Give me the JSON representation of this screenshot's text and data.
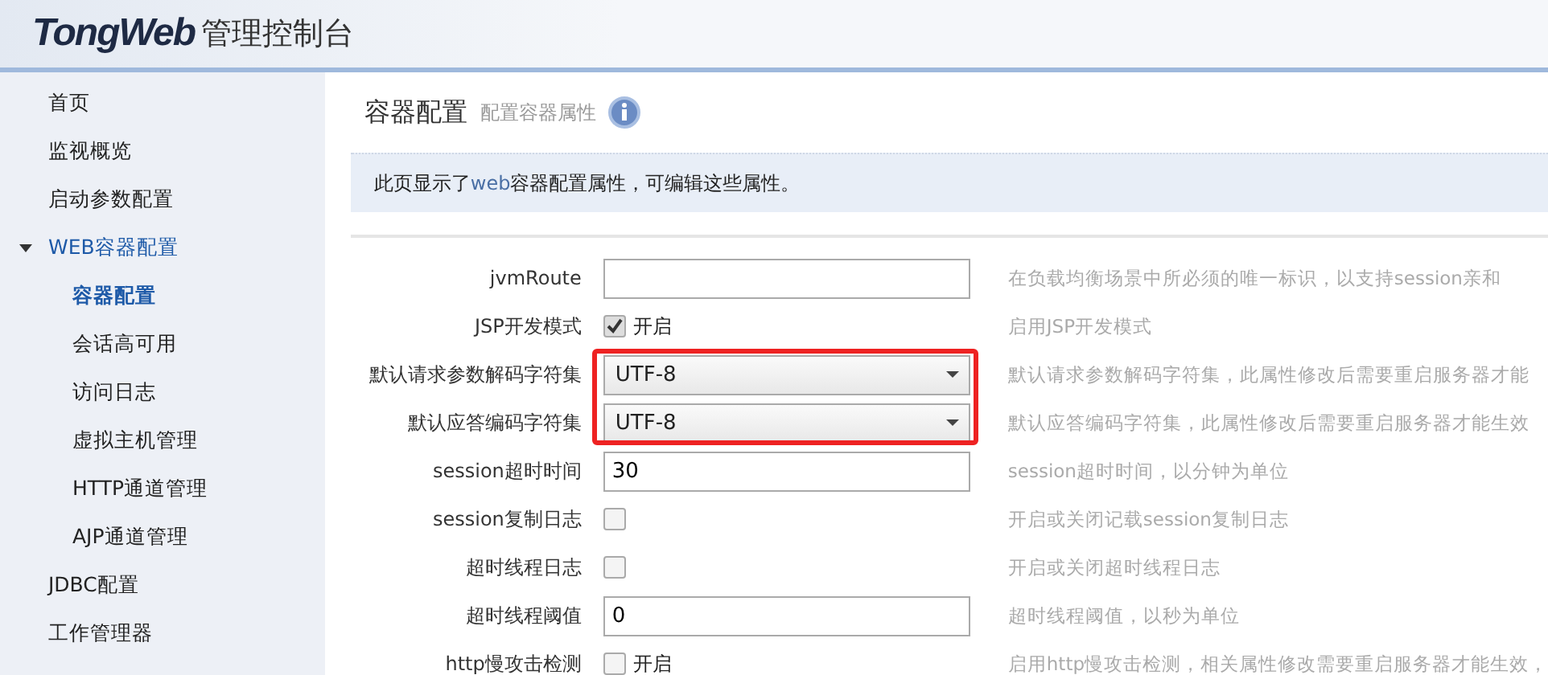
{
  "header": {
    "logo": "TongWeb",
    "title": "管理控制台"
  },
  "sidebar": {
    "items": [
      {
        "label": "首页",
        "selected": false
      },
      {
        "label": "监视概览",
        "selected": false
      },
      {
        "label": "启动参数配置",
        "selected": false
      },
      {
        "label": "WEB容器配置",
        "selected": false,
        "expanded": true,
        "children": [
          {
            "label": "容器配置",
            "selected": true
          },
          {
            "label": "会话高可用",
            "selected": false
          },
          {
            "label": "访问日志",
            "selected": false
          },
          {
            "label": "虚拟主机管理",
            "selected": false
          },
          {
            "label": "HTTP通道管理",
            "selected": false
          },
          {
            "label": "AJP通道管理",
            "selected": false
          }
        ]
      },
      {
        "label": "JDBC配置",
        "selected": false
      },
      {
        "label": "工作管理器",
        "selected": false
      }
    ]
  },
  "page": {
    "title": "容器配置",
    "subtitle": "配置容器属性",
    "info": "此页显示了**web**容器配置属性，可编辑这些属性。"
  },
  "form": {
    "rows": [
      {
        "kind": "text",
        "label": "jvmRoute",
        "value": "",
        "description": "在负载均衡场景中所必须的唯一标识，以支持session亲和"
      },
      {
        "kind": "checkbox",
        "label": "JSP开发模式",
        "checked": true,
        "option": "开启",
        "description": "启用JSP开发模式"
      },
      {
        "kind": "select",
        "label": "默认请求参数解码字符集",
        "value": "UTF-8",
        "highlighted": true,
        "description": "默认请求参数解码字符集，此属性修改后需要重启服务器才能"
      },
      {
        "kind": "select",
        "label": "默认应答编码字符集",
        "value": "UTF-8",
        "highlighted": true,
        "description": "默认应答编码字符集，此属性修改后需要重启服务器才能生效"
      },
      {
        "kind": "text",
        "label": "session超时时间",
        "value": "30",
        "description": "session超时时间，以分钟为单位"
      },
      {
        "kind": "checkbox",
        "label": "session复制日志",
        "checked": false,
        "description": "开启或关闭记载session复制日志"
      },
      {
        "kind": "checkbox",
        "label": "超时线程日志",
        "checked": false,
        "description": "开启或关闭超时线程日志"
      },
      {
        "kind": "text",
        "label": "超时线程阈值",
        "value": "0",
        "description": "超时线程阈值，以秒为单位"
      },
      {
        "kind": "checkbox",
        "label": "http慢攻击检测",
        "checked": false,
        "option": "开启",
        "description": "启用http慢攻击检测，相关属性修改需要重启服务器才能生效，"
      }
    ]
  }
}
